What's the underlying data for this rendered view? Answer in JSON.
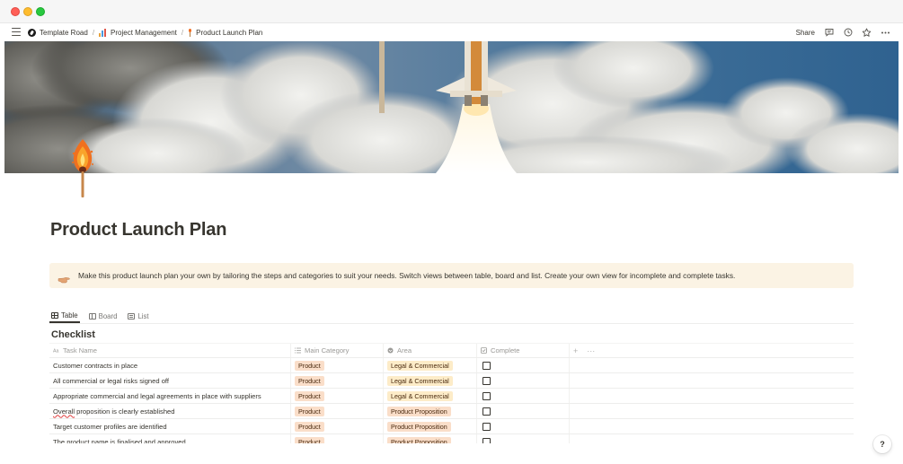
{
  "window": {
    "controls": [
      "close",
      "minimize",
      "zoom"
    ]
  },
  "breadcrumbs": [
    {
      "label": "Template Road",
      "icon": "template-road-logo-icon"
    },
    {
      "label": "Project Management",
      "icon": "bar-chart-icon"
    },
    {
      "label": "Product Launch Plan",
      "icon": "match-icon"
    }
  ],
  "topbar": {
    "share_label": "Share",
    "icons": [
      "comment-icon",
      "history-clock-icon",
      "star-icon",
      "more-icon"
    ]
  },
  "page": {
    "title": "Product Launch Plan",
    "callout": {
      "icon": "pointing-hand-icon",
      "text": "Make this product launch plan your own by tailoring the steps and categories to suit your needs. Switch views between table, board and list. Create your own view for incomplete and complete tasks."
    }
  },
  "views": [
    {
      "label": "Table",
      "active": true
    },
    {
      "label": "Board",
      "active": false
    },
    {
      "label": "List",
      "active": false
    }
  ],
  "database": {
    "title": "Checklist",
    "columns": {
      "name": "Task Name",
      "category": "Main Category",
      "area": "Area",
      "complete": "Complete"
    },
    "add_column": "+",
    "more": "···",
    "rows": [
      {
        "task": "Customer contracts in place",
        "category": "Product",
        "area": "Legal & Commercial",
        "complete": false
      },
      {
        "task": "All commercial or legal risks signed off",
        "category": "Product",
        "area": "Legal & Commercial",
        "complete": false
      },
      {
        "task": "Appropriate commercial and legal agreements in place with suppliers",
        "category": "Product",
        "area": "Legal & Commercial",
        "complete": false
      },
      {
        "task": "Overall proposition is clearly established",
        "category": "Product",
        "area": "Product Proposition",
        "complete": false
      },
      {
        "task": "Target customer profiles are identified",
        "category": "Product",
        "area": "Product Proposition",
        "complete": false
      },
      {
        "task": "The product name is finalised and approved",
        "category": "Product",
        "area": "Product Proposition",
        "complete": false
      }
    ]
  },
  "help": {
    "label": "?"
  },
  "colors": {
    "callout_bg": "#fbf3e4",
    "tag_product": "#fadec9",
    "tag_legal": "#fdecc8",
    "text": "#37352f"
  }
}
